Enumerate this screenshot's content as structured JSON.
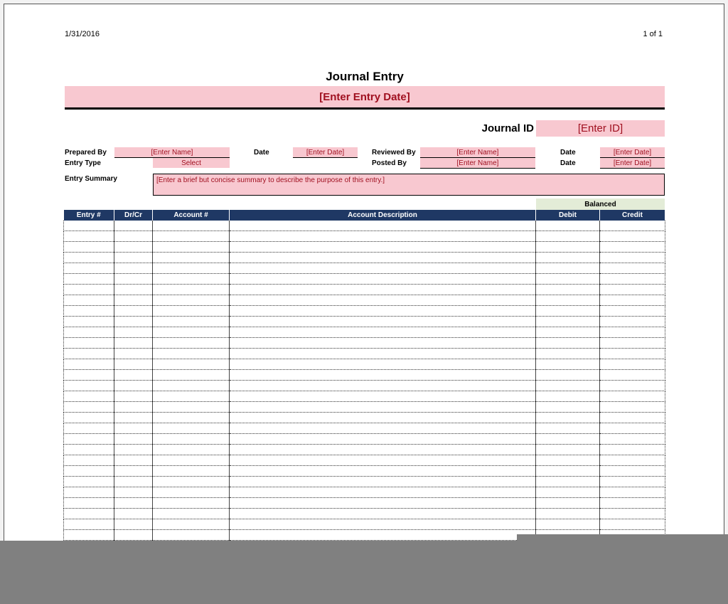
{
  "header": {
    "date": "1/31/2016",
    "page": "1 of 1"
  },
  "title": "Journal Entry",
  "entry_date_placeholder": "[Enter Entry Date]",
  "journal_id": {
    "label": "Journal ID",
    "placeholder": "[Enter ID]"
  },
  "form": {
    "prepared_by": {
      "label": "Prepared By",
      "value": "[Enter Name]"
    },
    "date1": {
      "label": "Date",
      "value": "[Enter Date]"
    },
    "reviewed_by": {
      "label": "Reviewed By",
      "value": "[Enter Name]"
    },
    "date2": {
      "label": "Date",
      "value": "[Enter Date]"
    },
    "entry_type": {
      "label": "Entry Type",
      "value": "Select"
    },
    "posted_by": {
      "label": "Posted By",
      "value": "[Enter Name]"
    },
    "date3": {
      "label": "Date",
      "value": "[Enter Date]"
    },
    "entry_summary": {
      "label": "Entry Summary",
      "value": "[Enter a brief but concise summary to describe the purpose of this entry.]"
    }
  },
  "balanced_label": "Balanced",
  "table": {
    "columns": [
      "Entry #",
      "Dr/Cr",
      "Account #",
      "Account Description",
      "Debit",
      "Credit"
    ]
  },
  "colors": {
    "accent_pink": "#f8c8d0",
    "header_navy": "#1f3864",
    "balanced_green": "#e3ecd7",
    "placeholder_red": "#a01020"
  }
}
